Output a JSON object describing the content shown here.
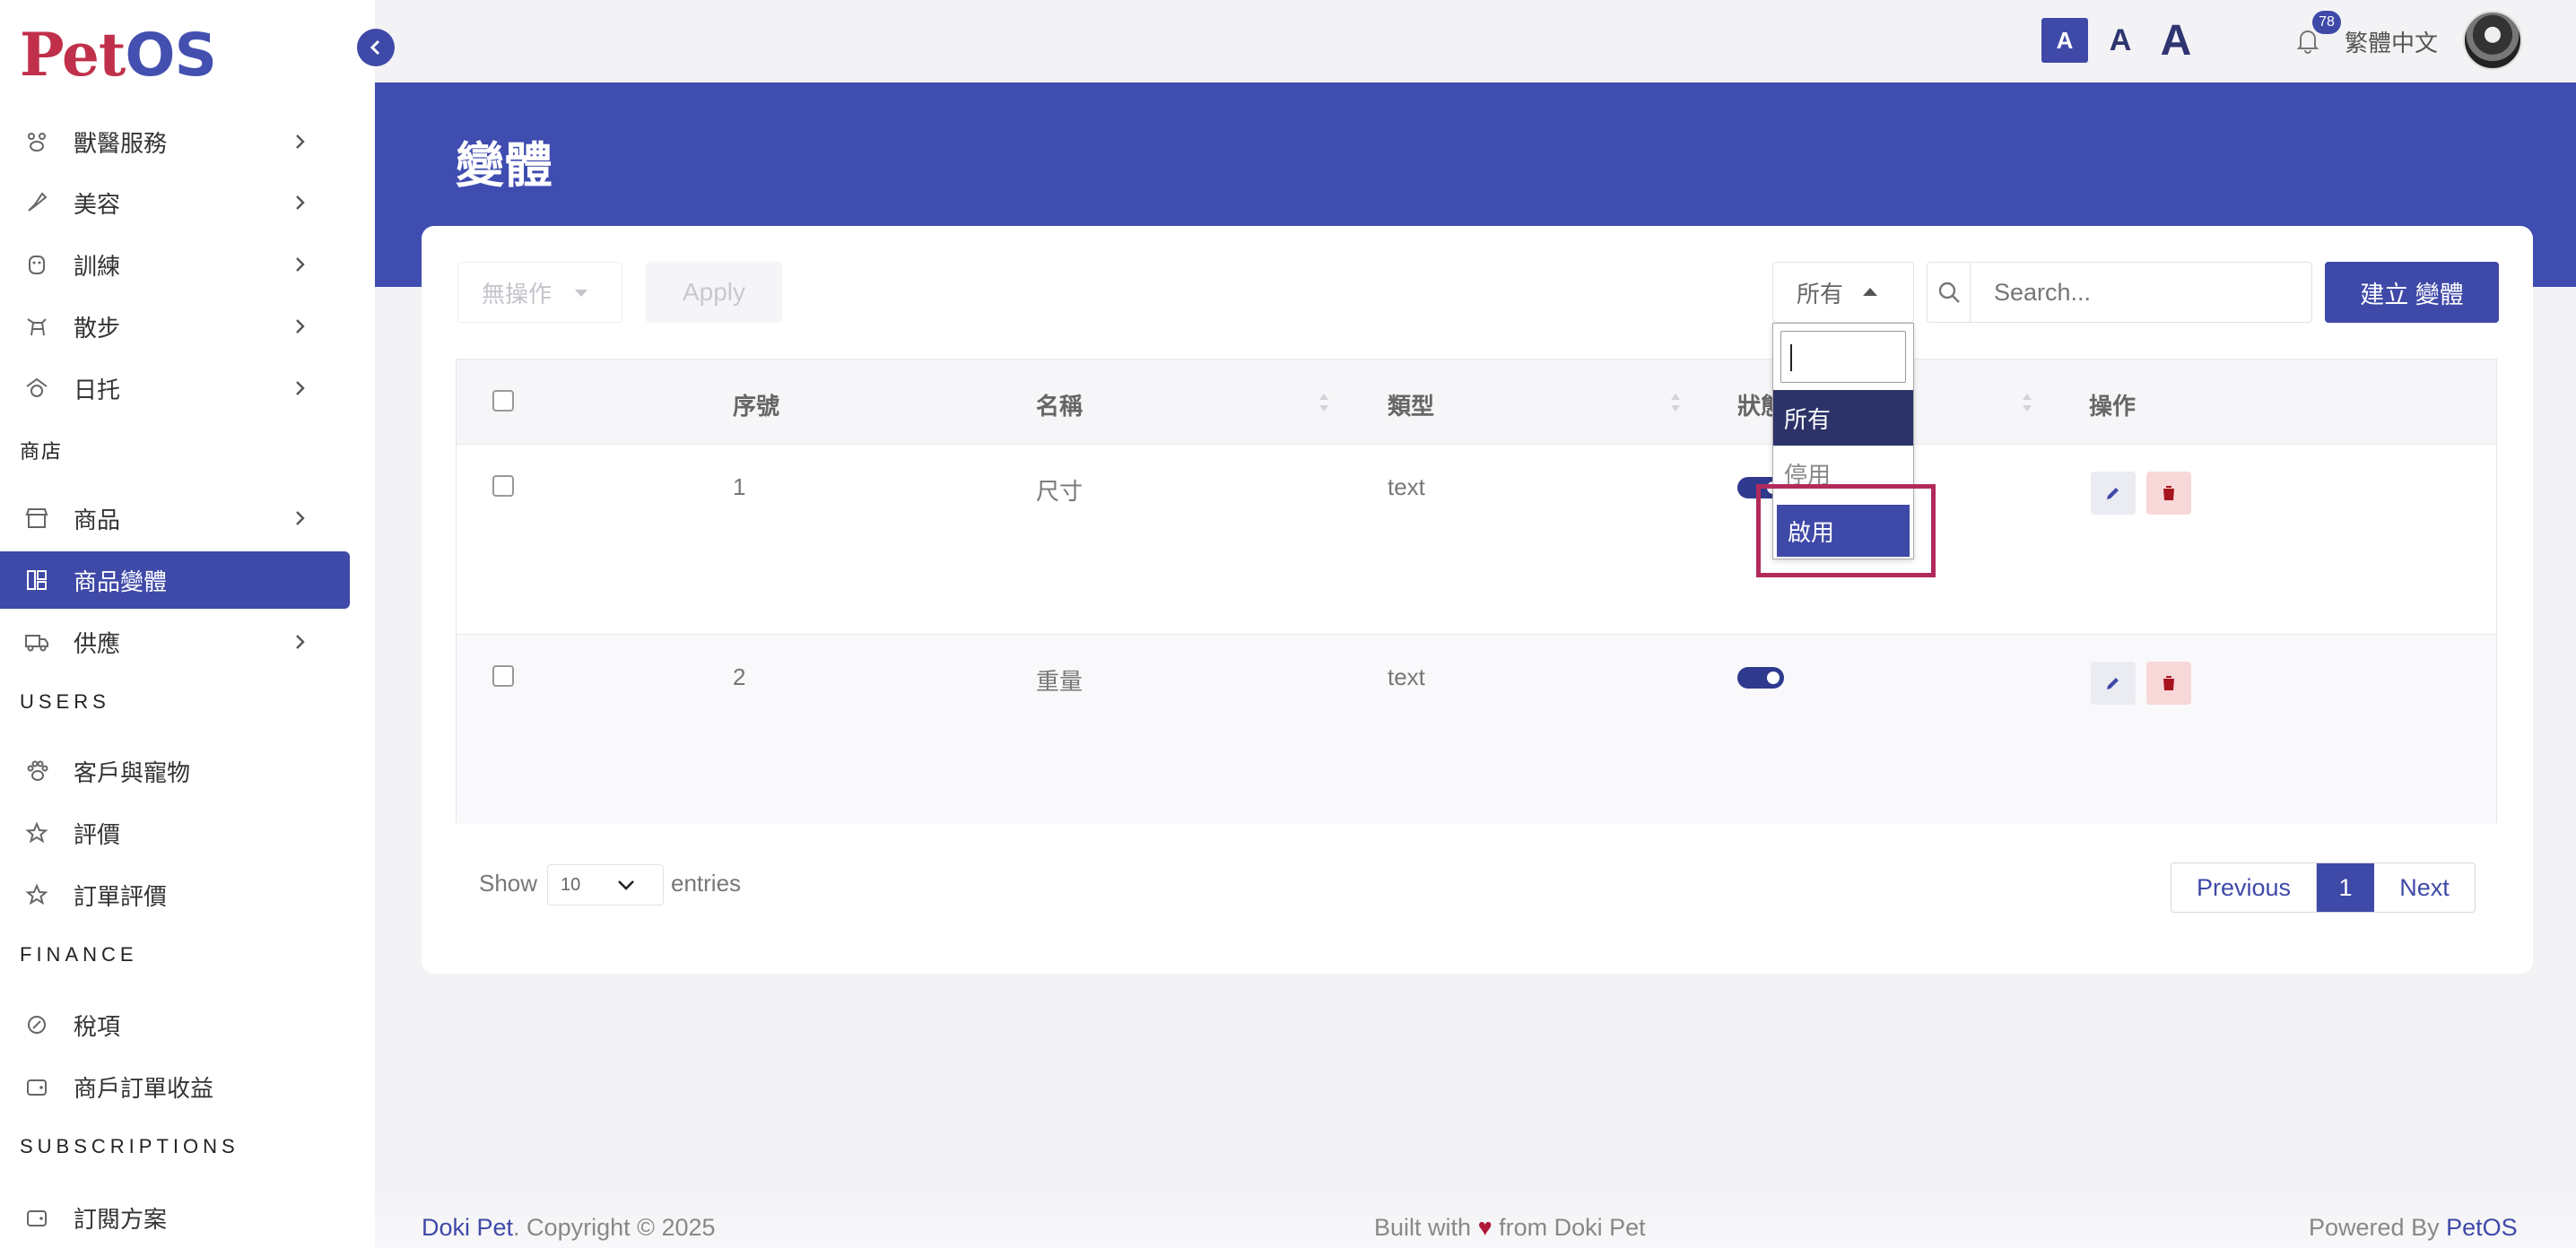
{
  "brand": {
    "logo_pet": "Pet",
    "logo_os": "OS"
  },
  "sidebar": {
    "items": [
      {
        "label": "獸醫服務",
        "icon": "paw-group-icon",
        "has_chevron": true
      },
      {
        "label": "美容",
        "icon": "brush-icon",
        "has_chevron": true
      },
      {
        "label": "訓練",
        "icon": "dog-face-icon",
        "has_chevron": true
      },
      {
        "label": "散步",
        "icon": "dog-walk-icon",
        "has_chevron": true
      },
      {
        "label": "日托",
        "icon": "daycare-icon",
        "has_chevron": true
      }
    ],
    "section_shop": "商店",
    "shop_items": [
      {
        "label": "商品",
        "icon": "store-icon",
        "has_chevron": true
      },
      {
        "label": "商品變體",
        "icon": "variant-icon",
        "active": true
      },
      {
        "label": "供應",
        "icon": "truck-icon",
        "has_chevron": true
      }
    ],
    "section_users": "USERS",
    "user_items": [
      {
        "label": "客戶與寵物",
        "icon": "paw-icon"
      },
      {
        "label": "評價",
        "icon": "star-icon"
      },
      {
        "label": "訂單評價",
        "icon": "star-icon"
      }
    ],
    "section_finance": "FINANCE",
    "finance_items": [
      {
        "label": "稅項",
        "icon": "tax-icon"
      },
      {
        "label": "商戶訂單收益",
        "icon": "wallet-icon"
      }
    ],
    "section_subscriptions": "SUBSCRIPTIONS",
    "subscription_items": [
      {
        "label": "訂閱方案",
        "icon": "wallet-icon"
      }
    ]
  },
  "topbar": {
    "font_small": "A",
    "font_medium": "A",
    "font_large": "A",
    "notification_count": "78",
    "language": "繁體中文"
  },
  "page": {
    "title": "變體"
  },
  "toolbar": {
    "bulk_action": "無操作",
    "apply": "Apply",
    "status_filter": "所有",
    "search_placeholder": "Search...",
    "create": "建立 變體"
  },
  "status_dropdown": {
    "options": [
      "所有",
      "停用",
      "啟用"
    ],
    "highlighted": "所有",
    "hovered": "啟用"
  },
  "table": {
    "headers": [
      "序號",
      "名稱",
      "類型",
      "狀態",
      "操作"
    ],
    "rows": [
      {
        "id": "1",
        "name": "尺寸",
        "type": "text",
        "enabled": true
      },
      {
        "id": "2",
        "name": "重量",
        "type": "text",
        "enabled": true
      }
    ]
  },
  "pagination": {
    "show": "Show",
    "entries_value": "10",
    "entries": "entries",
    "previous": "Previous",
    "current": "1",
    "next": "Next"
  },
  "footer": {
    "left_brand": "Doki Pet",
    "left_rest": ". Copyright © 2025",
    "middle_a": "Built with",
    "middle_b": "from Doki Pet",
    "right_a": "Powered By",
    "right_brand": "PetOS"
  },
  "colors": {
    "primary": "#3f49a8",
    "brand_red": "#c0304a",
    "highlight_box": "#b12a5b"
  }
}
